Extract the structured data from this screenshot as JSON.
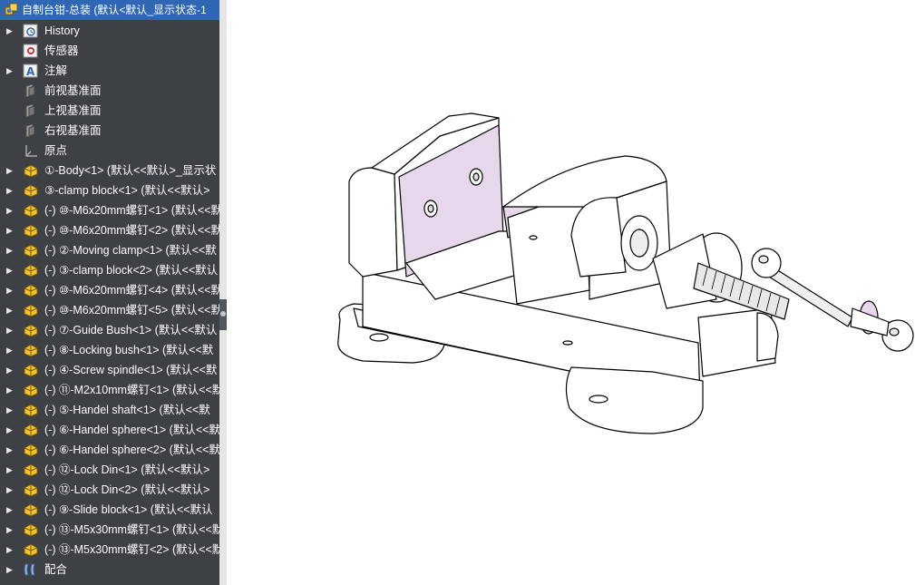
{
  "tree": {
    "title": "自制台钳-总装 (默认<默认_显示状态-1",
    "items": [
      {
        "label": "History",
        "icon": "history-icon",
        "expandable": true
      },
      {
        "label": "传感器",
        "icon": "sensor-icon",
        "expandable": false
      },
      {
        "label": "注解",
        "icon": "annotation-icon",
        "expandable": true
      },
      {
        "label": "前视基准面",
        "icon": "plane-icon",
        "expandable": false
      },
      {
        "label": "上视基准面",
        "icon": "plane-icon",
        "expandable": false
      },
      {
        "label": "右视基准面",
        "icon": "plane-icon",
        "expandable": false
      },
      {
        "label": "原点",
        "icon": "origin-icon",
        "expandable": false
      },
      {
        "label": "①-Body<1> (默认<<默认>_显示状",
        "icon": "part-icon",
        "expandable": true
      },
      {
        "label": "③-clamp block<1> (默认<<默认>",
        "icon": "part-icon",
        "expandable": true
      },
      {
        "label": "(-) ⑩-M6x20mm螺钉<1> (默认<<默",
        "icon": "part-icon",
        "expandable": true
      },
      {
        "label": "(-) ⑩-M6x20mm螺钉<2> (默认<<默",
        "icon": "part-icon",
        "expandable": true
      },
      {
        "label": "(-) ②-Moving clamp<1> (默认<<默",
        "icon": "part-icon",
        "expandable": true
      },
      {
        "label": "(-) ③-clamp block<2> (默认<<默认",
        "icon": "part-icon",
        "expandable": true
      },
      {
        "label": "(-) ⑩-M6x20mm螺钉<4> (默认<<默",
        "icon": "part-icon",
        "expandable": true
      },
      {
        "label": "(-) ⑩-M6x20mm螺钉<5> (默认<<默",
        "icon": "part-icon",
        "expandable": true
      },
      {
        "label": "(-) ⑦-Guide Bush<1> (默认<<默认",
        "icon": "part-icon",
        "expandable": true
      },
      {
        "label": "(-) ⑧-Locking bush<1> (默认<<默",
        "icon": "part-icon",
        "expandable": true
      },
      {
        "label": "(-) ④-Screw spindle<1> (默认<<默",
        "icon": "part-icon",
        "expandable": true
      },
      {
        "label": "(-) ⑪-M2x10mm螺钉<1> (默认<<默",
        "icon": "part-icon",
        "expandable": true
      },
      {
        "label": "(-) ⑤-Handel shaft<1> (默认<<默",
        "icon": "part-icon",
        "expandable": true
      },
      {
        "label": "(-) ⑥-Handel sphere<1> (默认<<默",
        "icon": "part-icon",
        "expandable": true
      },
      {
        "label": "(-) ⑥-Handel sphere<2> (默认<<默",
        "icon": "part-icon",
        "expandable": true
      },
      {
        "label": "(-) ⑫-Lock Din<1> (默认<<默认>",
        "icon": "part-icon",
        "expandable": true
      },
      {
        "label": "(-) ⑫-Lock Din<2> (默认<<默认>",
        "icon": "part-icon",
        "expandable": true
      },
      {
        "label": "(-) ⑨-Slide block<1> (默认<<默认",
        "icon": "part-icon",
        "expandable": true
      },
      {
        "label": "(-) ⑬-M5x30mm螺钉<1> (默认<<默",
        "icon": "part-icon",
        "expandable": true
      },
      {
        "label": "(-) ⑬-M5x30mm螺钉<2> (默认<<默",
        "icon": "part-icon",
        "expandable": true
      },
      {
        "label": "配合",
        "icon": "mates-icon",
        "expandable": true
      }
    ]
  },
  "model": {
    "name": "bench-vise-assembly",
    "color_body": "#ffffff",
    "color_jaw": "#e6d8ea",
    "color_outline": "#000000"
  }
}
